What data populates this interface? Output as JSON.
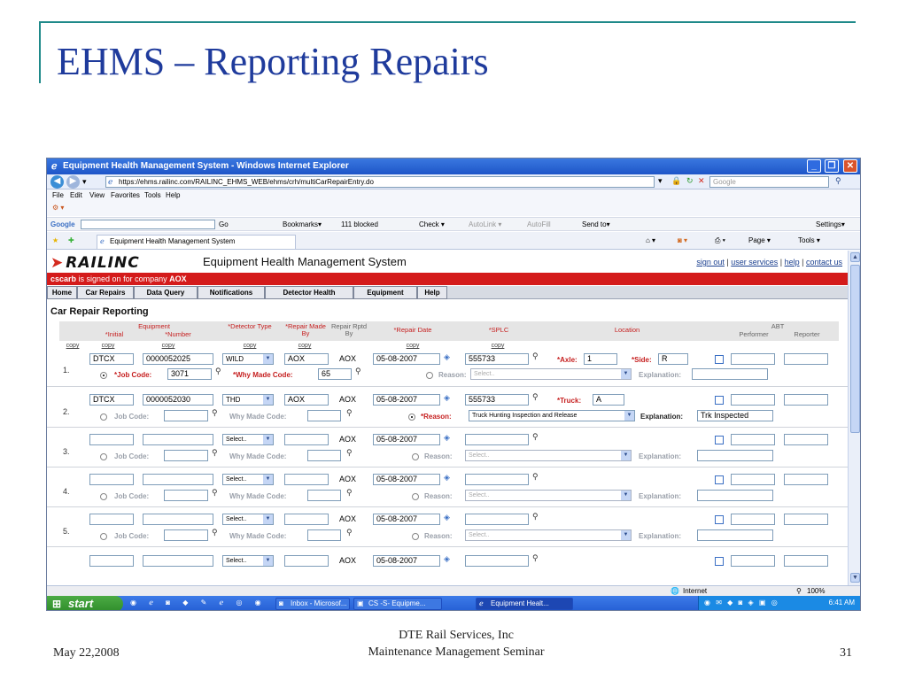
{
  "slide": {
    "title": "EHMS – Reporting Repairs",
    "footer_date": "May 22,2008",
    "footer_line1": "DTE Rail Services, Inc",
    "footer_line2": "Maintenance Management Seminar",
    "page_number": "31"
  },
  "browser": {
    "window_title": "Equipment Health Management System - Windows Internet Explorer",
    "url": "https://ehms.railinc.com/RAILINC_EHMS_WEB/ehms/crh/multiCarRepairEntry.do",
    "search_placeholder": "Google",
    "menu": [
      "File",
      "Edit",
      "View",
      "Favorites",
      "Tools",
      "Help"
    ],
    "google_toolbar": {
      "label": "Google",
      "go": "Go",
      "bookmarks": "Bookmarks▾",
      "blocked": "111 blocked",
      "check": "Check ▾",
      "autolink": "AutoLink ▾",
      "autofill": "AutoFill",
      "send_to": "Send to▾",
      "settings": "Settings▾"
    },
    "tab_label": "Equipment Health Management System",
    "page_menu": "Page ▾",
    "tools_menu": "Tools ▾",
    "status_zone": "Internet",
    "zoom": "100%"
  },
  "app": {
    "logo": "RAILINC",
    "title": "Equipment Health Management System",
    "links": [
      "sign out",
      "user services",
      "help",
      "contact us"
    ],
    "signed_on_user": "cscarb",
    "signed_on_text": " is signed on for company ",
    "company": "AOX",
    "nav": [
      "Home",
      "Car Repairs",
      "Data Query",
      "Notifications",
      "Detector Health",
      "Equipment",
      "Help"
    ],
    "section_title": "Car Repair Reporting"
  },
  "table_headers": {
    "equipment": "Equipment",
    "initial": "*Initial",
    "number": "*Number",
    "detector_type": "*Detector Type",
    "repair_made_by": "*Repair Made By",
    "repair_rptd_by": "Repair Rptd By",
    "repair_date": "*Repair Date",
    "splc": "*SPLC",
    "location": "Location",
    "abt": "ABT",
    "performer": "Performer",
    "reporter": "Reporter",
    "copy": "copy"
  },
  "labels": {
    "job_code": "Job Code:",
    "job_code_req": "*Job Code:",
    "why_made_code": "Why Made Code:",
    "why_made_code_req": "*Why Made Code:",
    "reason": "Reason:",
    "reason_req": "*Reason:",
    "explanation": "Explanation:",
    "axle": "*Axle:",
    "side": "*Side:",
    "truck": "*Truck:",
    "select": "Select.."
  },
  "rows": [
    {
      "num": "1.",
      "initial": "DTCX",
      "number": "0000052025",
      "detector": "WILD",
      "made_by": "AOX",
      "rptd_by": "AOX",
      "date": "05-08-2007",
      "splc": "555733",
      "axle": "1",
      "side": "R",
      "job_code": "3071",
      "why_made": "65",
      "reason": "Select..",
      "explanation": ""
    },
    {
      "num": "2.",
      "initial": "DTCX",
      "number": "0000052030",
      "detector": "THD",
      "made_by": "AOX",
      "rptd_by": "AOX",
      "date": "05-08-2007",
      "splc": "555733",
      "truck": "A",
      "job_code": "",
      "why_made": "",
      "reason": "Truck Hunting Inspection and Release",
      "explanation": "Trk Inspected"
    },
    {
      "num": "3.",
      "initial": "",
      "number": "",
      "detector": "Select..",
      "made_by": "",
      "rptd_by": "AOX",
      "date": "05-08-2007",
      "splc": "",
      "reason": "Select..",
      "explanation": ""
    },
    {
      "num": "4.",
      "initial": "",
      "number": "",
      "detector": "Select..",
      "made_by": "",
      "rptd_by": "AOX",
      "date": "05-08-2007",
      "splc": "",
      "reason": "Select..",
      "explanation": ""
    },
    {
      "num": "5.",
      "initial": "",
      "number": "",
      "detector": "Select..",
      "made_by": "",
      "rptd_by": "AOX",
      "date": "05-08-2007",
      "splc": "",
      "reason": "Select..",
      "explanation": ""
    },
    {
      "num": "",
      "initial": "",
      "number": "",
      "detector": "Select..",
      "made_by": "",
      "rptd_by": "AOX",
      "date": "05-08-2007",
      "splc": ""
    }
  ],
  "taskbar": {
    "start": "start",
    "items": [
      "Inbox - Microsof...",
      "CS -S- Equipme...",
      "Equipment Healt..."
    ],
    "clock": "6:41 AM"
  }
}
